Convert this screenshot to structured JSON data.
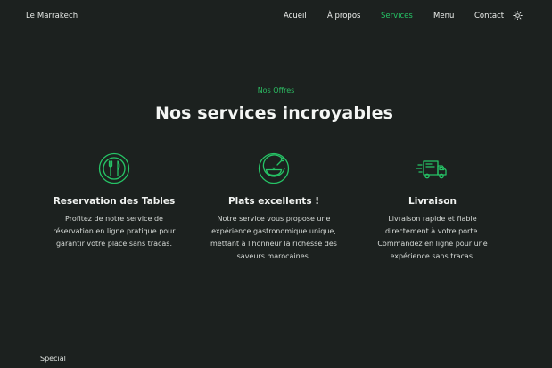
{
  "nav": {
    "brand": "Le Marrakech",
    "links": [
      {
        "label": "Acueil"
      },
      {
        "label": "À propos"
      },
      {
        "label": "Services"
      },
      {
        "label": "Menu"
      },
      {
        "label": "Contact"
      }
    ],
    "active": "Services",
    "theme_icon": "sun-icon"
  },
  "section": {
    "eyebrow": "Nos Offres",
    "title": "Nos services incroyables"
  },
  "services": [
    {
      "icon": "fork-knife-plate-icon",
      "title": "Reservation des Tables",
      "text": "Profitez de notre service de réservation en ligne pratique pour garantir votre place sans tracas."
    },
    {
      "icon": "dish-icon",
      "title": "Plats excellents !",
      "text": "Notre service vous propose une expérience gastronomique unique, mettant à l'honneur la richesse des saveurs marocaines."
    },
    {
      "icon": "delivery-truck-icon",
      "title": "Livraison",
      "text": "Livraison rapide et fiable directement à votre porte. Commandez en ligne pour une expérience sans tracas."
    }
  ],
  "next_section": {
    "label": "Special"
  },
  "colors": {
    "background": "#1c211f",
    "accent": "#26c466",
    "text": "#eef0ee"
  }
}
